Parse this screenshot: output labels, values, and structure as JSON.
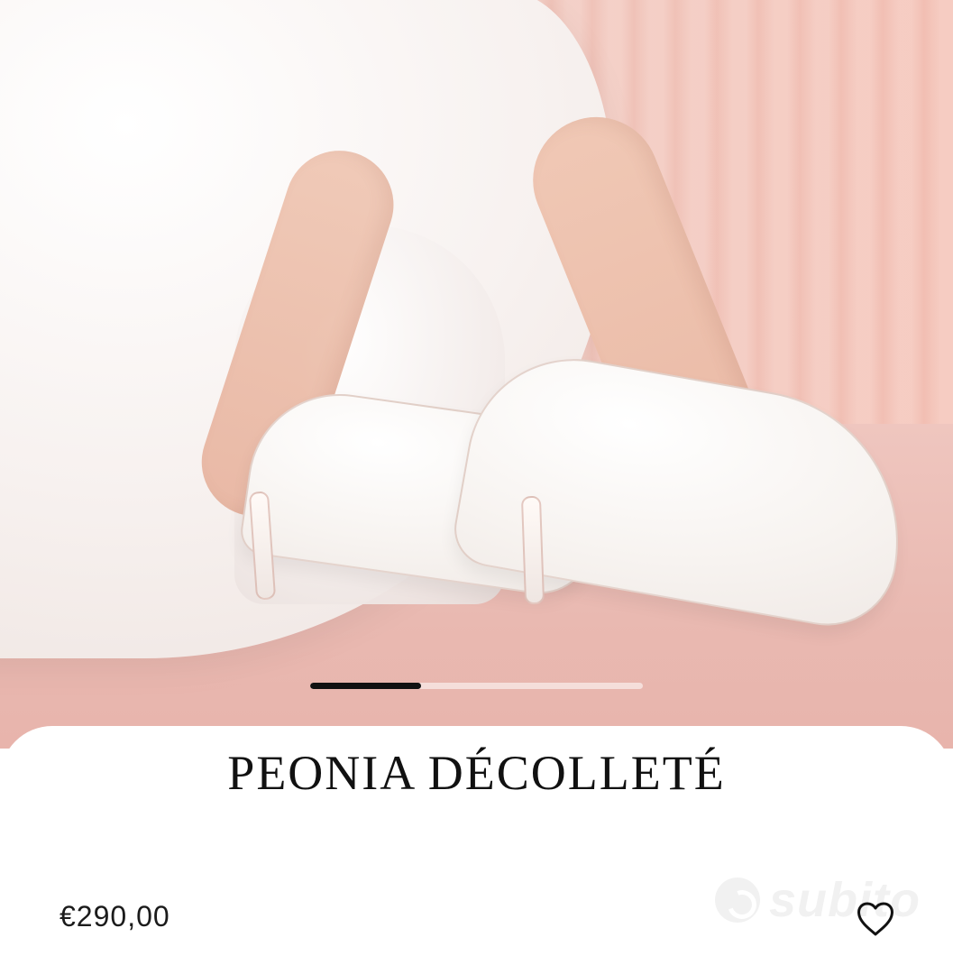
{
  "product": {
    "title": "PEONIA DÉCOLLETÉ",
    "price": "€290,00"
  },
  "carousel": {
    "active_index": 1,
    "total": 3
  },
  "watermark": {
    "text": "subito"
  },
  "icons": {
    "favorite": "heart-outline-icon",
    "watermark_mark": "subito-logo-icon"
  },
  "colors": {
    "background_pink": "#f1c8be",
    "sheet_white": "#ffffff",
    "text_primary": "#111111",
    "carousel_active": "#111111",
    "watermark": "#c9c9c9"
  }
}
